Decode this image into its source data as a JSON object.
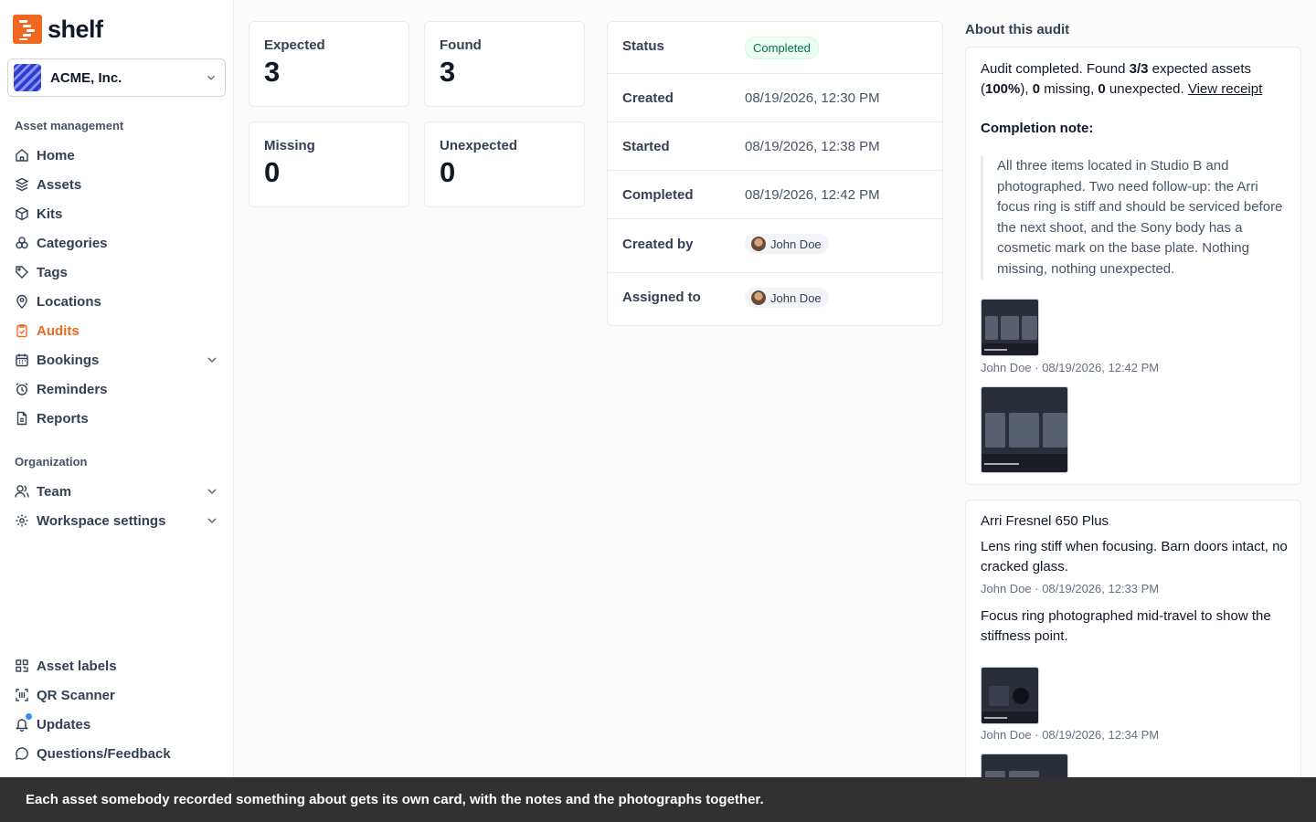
{
  "brand": {
    "name": "shelf",
    "color": "#ef6820"
  },
  "workspace": {
    "name": "ACME, Inc."
  },
  "sidebar": {
    "section_asset": "Asset management",
    "items": [
      {
        "label": "Home",
        "icon": "home-icon"
      },
      {
        "label": "Assets",
        "icon": "cube-icon"
      },
      {
        "label": "Kits",
        "icon": "package-icon"
      },
      {
        "label": "Categories",
        "icon": "shapes-icon"
      },
      {
        "label": "Tags",
        "icon": "tag-icon"
      },
      {
        "label": "Locations",
        "icon": "map-pin-icon"
      },
      {
        "label": "Audits",
        "icon": "clipboard-check-icon",
        "active": true
      },
      {
        "label": "Bookings",
        "icon": "calendar-icon",
        "expandable": true
      },
      {
        "label": "Reminders",
        "icon": "alarm-icon"
      },
      {
        "label": "Reports",
        "icon": "file-icon"
      }
    ],
    "section_org": "Organization",
    "org_items": [
      {
        "label": "Team",
        "icon": "users-icon"
      },
      {
        "label": "Workspace settings",
        "icon": "gear-icon"
      }
    ],
    "bottom_items": [
      {
        "label": "Asset labels",
        "icon": "qr-code-icon"
      },
      {
        "label": "QR Scanner",
        "icon": "scan-icon"
      },
      {
        "label": "Updates",
        "icon": "bell-icon"
      },
      {
        "label": "Questions/Feedback",
        "icon": "message-icon"
      }
    ]
  },
  "stats": {
    "expected": {
      "label": "Expected",
      "value": "3"
    },
    "found": {
      "label": "Found",
      "value": "3"
    },
    "missing": {
      "label": "Missing",
      "value": "0"
    },
    "unexpected": {
      "label": "Unexpected",
      "value": "0"
    }
  },
  "details": {
    "status_label": "Status",
    "status_value": "Completed",
    "status_color": "#067647",
    "created_label": "Created",
    "created_value": "08/19/2026, 12:30 PM",
    "started_label": "Started",
    "started_value": "08/19/2026, 12:38 PM",
    "completed_label": "Completed",
    "completed_value": "08/19/2026, 12:42 PM",
    "created_by_label": "Created by",
    "created_by_value": "John Doe",
    "assigned_label": "Assigned to",
    "assigned_value": "John Doe"
  },
  "about": {
    "title": "About this audit",
    "summary_prefix": "Audit completed. Found ",
    "found_ratio": "3/3",
    "summary_mid1": " expected assets (",
    "percent": "100%",
    "summary_mid2": "), ",
    "missing": "0",
    "summary_mid3": " missing, ",
    "unexpected": "0",
    "summary_mid4": " unexpected. ",
    "receipt_link": "View receipt",
    "note_heading": "Completion note:",
    "note_text": "All three items located in Studio B and photographed. Two need follow-up: the Arri focus ring is stiff and should be serviced before the next shoot, and the Sony body has a cosmetic mark on the base plate. Nothing missing, nothing unexpected.",
    "photo_meta": "John Doe · 08/19/2026, 12:42 PM"
  },
  "asset_card": {
    "title": "Arri Fresnel 650 Plus",
    "note1": "Lens ring stiff when focusing. Barn doors intact, no cracked glass.",
    "note1_meta": "John Doe · 08/19/2026, 12:33 PM",
    "note2": "Focus ring photographed mid-travel to show the stiffness point.",
    "photo_meta": "John Doe · 08/19/2026, 12:34 PM"
  },
  "caption": "Each asset somebody recorded something about gets its own card, with the notes and the photographs together."
}
